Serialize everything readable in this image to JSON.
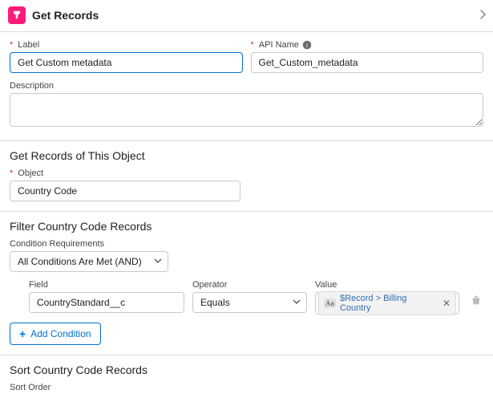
{
  "header": {
    "title": "Get Records"
  },
  "basics": {
    "label_lbl": "Label",
    "label_val": "Get Custom metadata",
    "api_lbl": "API Name",
    "api_val": "Get_Custom_metadata",
    "desc_lbl": "Description",
    "desc_val": ""
  },
  "objectSection": {
    "title": "Get Records of This Object",
    "object_lbl": "Object",
    "object_val": "Country Code"
  },
  "filterSection": {
    "title": "Filter Country Code Records",
    "cond_req_lbl": "Condition Requirements",
    "cond_req_val": "All Conditions Are Met (AND)",
    "field_lbl": "Field",
    "field_val": "CountryStandard__c",
    "operator_lbl": "Operator",
    "operator_val": "Equals",
    "value_lbl": "Value",
    "value_chip": "$Record > Billing Country",
    "add_condition": "Add Condition"
  },
  "sortSection": {
    "title": "Sort Country Code Records",
    "sort_order_lbl": "Sort Order"
  }
}
